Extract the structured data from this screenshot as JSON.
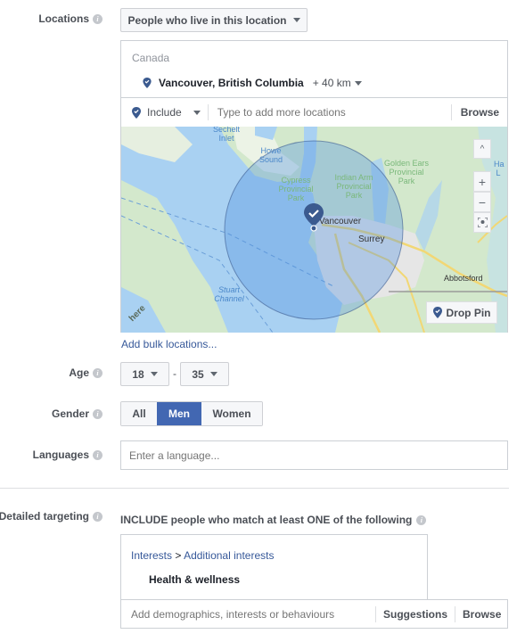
{
  "locations": {
    "label": "Locations",
    "audience_type_dropdown": "People who live in this location",
    "country": "Canada",
    "selected_location": {
      "name": "Vancouver, British Columbia",
      "radius": "+ 40 km"
    },
    "include_dropdown": "Include",
    "search_placeholder": "Type to add more locations",
    "browse_label": "Browse",
    "map": {
      "labels": {
        "sechelt_inlet": "Sechelt Inlet",
        "howe_sound": "Howe Sound",
        "cypress_park": "Cypress Provincial Park",
        "indian_arm_park": "Indian Arm Provincial Park",
        "golden_ears_park": "Golden Ears Provincial Park",
        "vancouver": "Vancouver",
        "surrey": "Surrey",
        "abbotsford": "Abbotsford",
        "stuart_channel": "Stuart Channel",
        "edge_label": "Ha L",
        "attribution": "here"
      },
      "controls": {
        "collapse": "^",
        "zoom_in": "+",
        "zoom_out": "−"
      },
      "drop_pin_label": "Drop Pin"
    },
    "bulk_link": "Add bulk locations..."
  },
  "age": {
    "label": "Age",
    "min": "18",
    "separator": "-",
    "max": "35"
  },
  "gender": {
    "label": "Gender",
    "options": [
      "All",
      "Men",
      "Women"
    ],
    "selected": "Men"
  },
  "languages": {
    "label": "Languages",
    "placeholder": "Enter a language..."
  },
  "detailed_targeting": {
    "label": "Detailed targeting",
    "include_text": "INCLUDE people who match at least ONE of the following",
    "breadcrumb": {
      "parent": "Interests",
      "separator": ">",
      "child": "Additional interests"
    },
    "selected_item": "Health & wellness",
    "search_placeholder": "Add demographics, interests or behaviours",
    "suggestions_label": "Suggestions",
    "browse_label": "Browse"
  },
  "colors": {
    "accent": "#4267b2",
    "link": "#365899",
    "pin": "#3b5a8f"
  }
}
